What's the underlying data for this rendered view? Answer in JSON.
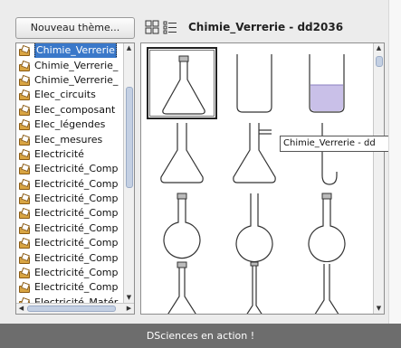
{
  "left_panel": {
    "new_theme_label": "Nouveau thème...",
    "items": [
      {
        "label": "Chimie_Verrerie",
        "selected": true
      },
      {
        "label": "Chimie_Verrerie_",
        "selected": false
      },
      {
        "label": "Chimie_Verrerie_",
        "selected": false
      },
      {
        "label": "Elec_circuits",
        "selected": false
      },
      {
        "label": "Elec_composant",
        "selected": false
      },
      {
        "label": "Elec_légendes",
        "selected": false
      },
      {
        "label": "Elec_mesures",
        "selected": false
      },
      {
        "label": "Electricité",
        "selected": false
      },
      {
        "label": "Electricité_Comp",
        "selected": false
      },
      {
        "label": "Electricité_Comp",
        "selected": false
      },
      {
        "label": "Electricité_Comp",
        "selected": false
      },
      {
        "label": "Electricité_Comp",
        "selected": false
      },
      {
        "label": "Electricité_Comp",
        "selected": false
      },
      {
        "label": "Electricité_Comp",
        "selected": false
      },
      {
        "label": "Electricité_Comp",
        "selected": false
      },
      {
        "label": "Electricité_Comp",
        "selected": false
      },
      {
        "label": "Electricité_Comp",
        "selected": false
      },
      {
        "label": "Electricité_Matér",
        "selected": false
      }
    ]
  },
  "toolbar": {
    "title": "Chimie_Verrerie - dd2036",
    "icons": [
      "grid-view-icon",
      "list-view-icon"
    ]
  },
  "gallery": {
    "items": [
      {
        "icon": "erlenmeyer-flask-icon",
        "selected": true
      },
      {
        "icon": "beaker-icon",
        "selected": false
      },
      {
        "icon": "beaker-with-liquid-icon",
        "selected": false
      },
      {
        "icon": "erlenmeyer-outline-icon",
        "selected": false
      },
      {
        "icon": "side-arm-flask-icon",
        "selected": false
      },
      {
        "icon": "tube-hook-icon",
        "selected": false
      },
      {
        "icon": "round-flask-icon",
        "selected": false
      },
      {
        "icon": "round-flask-long-neck-icon",
        "selected": false
      },
      {
        "icon": "round-flask-stoppered-icon",
        "selected": false
      },
      {
        "icon": "volumetric-flask-icon",
        "selected": false
      },
      {
        "icon": "volumetric-flask-narrow-icon",
        "selected": false
      },
      {
        "icon": "volumetric-flask-tall-icon",
        "selected": false
      }
    ],
    "tooltip": "Chimie_Verrerie - dd"
  },
  "footer": {
    "text": "DSciences en action !"
  },
  "colors": {
    "selection": "#3a78c9",
    "footer_bg": "#6d6d6d",
    "liquid": "#c9c0e8"
  }
}
